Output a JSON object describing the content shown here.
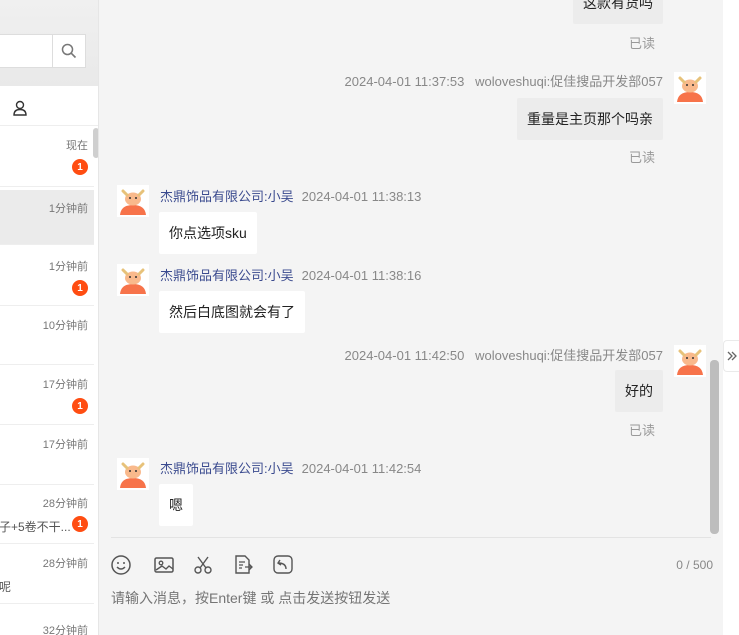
{
  "sidebar": {
    "conversations": [
      {
        "time": "现在",
        "badge": "1",
        "snippet": ""
      },
      {
        "time": "1分钟前",
        "badge": "",
        "snippet": ""
      },
      {
        "time": "1分钟前",
        "badge": "1",
        "snippet": ""
      },
      {
        "time": "10分钟前",
        "badge": "",
        "snippet": ""
      },
      {
        "time": "17分钟前",
        "badge": "1",
        "snippet": ""
      },
      {
        "time": "17分钟前",
        "badge": "",
        "snippet": ""
      },
      {
        "time": "28分钟前",
        "badge": "1",
        "snippet": "子+5卷不干..."
      },
      {
        "time": "28分钟前",
        "badge": "",
        "snippet": "呢"
      },
      {
        "time": "32分钟前",
        "badge": "",
        "snippet": ""
      }
    ]
  },
  "chat": {
    "messages": [
      {
        "text": "这款有货吗",
        "read": "已读"
      },
      {
        "time": "2024-04-01 11:37:53",
        "sender": "woloveshuqi:促佳搜品开发部057",
        "text": "重量是主页那个吗亲",
        "read": "已读"
      },
      {
        "sender": "杰鼎饰品有限公司:小吴",
        "time": "2024-04-01 11:38:13",
        "text": "你点选项sku"
      },
      {
        "sender": "杰鼎饰品有限公司:小吴",
        "time": "2024-04-01 11:38:16",
        "text": "然后白底图就会有了"
      },
      {
        "time": "2024-04-01 11:42:50",
        "sender": "woloveshuqi:促佳搜品开发部057",
        "text": "好的",
        "read": "已读"
      },
      {
        "sender": "杰鼎饰品有限公司:小吴",
        "time": "2024-04-01 11:42:54",
        "text": "嗯"
      }
    ],
    "counter": "0 / 500",
    "input_placeholder": "请输入消息，按Enter键 或 点击发送按钮发送"
  },
  "colors": {
    "badge": "#ff4d12",
    "sender_name": "#3b4b8f",
    "avatar": "#f7734a"
  }
}
